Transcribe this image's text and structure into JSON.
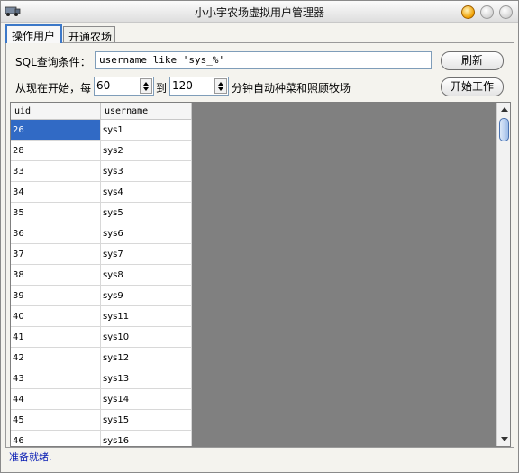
{
  "window": {
    "title": "小小宇农场虚拟用户管理器"
  },
  "tabs": [
    {
      "label": "操作用户",
      "active": true
    },
    {
      "label": "开通农场",
      "active": false
    }
  ],
  "query": {
    "label": "SQL查询条件：",
    "value": "username like 'sys_%'",
    "refresh_button": "刷新"
  },
  "schedule": {
    "prefix": "从现在开始，每",
    "from_value": "60",
    "to_label": "到",
    "to_value": "120",
    "suffix": "分钟自动种菜和照顾牧场",
    "start_button": "开始工作"
  },
  "table": {
    "columns": [
      "uid",
      "username"
    ],
    "rows": [
      [
        "26",
        "sys1"
      ],
      [
        "28",
        "sys2"
      ],
      [
        "33",
        "sys3"
      ],
      [
        "34",
        "sys4"
      ],
      [
        "35",
        "sys5"
      ],
      [
        "36",
        "sys6"
      ],
      [
        "37",
        "sys7"
      ],
      [
        "38",
        "sys8"
      ],
      [
        "39",
        "sys9"
      ],
      [
        "40",
        "sys11"
      ],
      [
        "41",
        "sys10"
      ],
      [
        "42",
        "sys12"
      ],
      [
        "43",
        "sys13"
      ],
      [
        "44",
        "sys14"
      ],
      [
        "45",
        "sys15"
      ],
      [
        "46",
        "sys16"
      ]
    ],
    "selected_row": 0
  },
  "status": {
    "text": "准备就绪."
  },
  "colors": {
    "selection": "#316ac5",
    "status_text": "#0a1eb4",
    "grid_background": "#808080"
  }
}
